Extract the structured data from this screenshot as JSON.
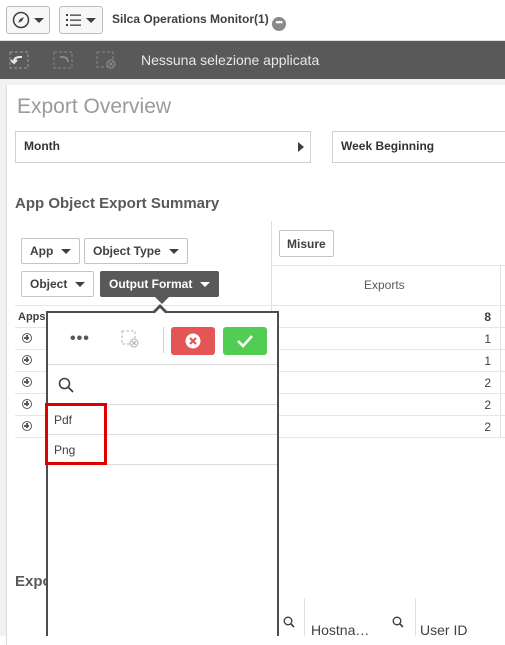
{
  "toolbar": {
    "app_title": "Silca Operations Monitor(1)",
    "more_glyph": "•••",
    "compass_icon": "compass-icon",
    "list_icon": "list-icon"
  },
  "selection_bar": {
    "text": "Nessuna selezione applicata",
    "icons": [
      "step-back-icon",
      "step-forward-icon",
      "clear-selections-icon"
    ]
  },
  "sheet": {
    "title": "Export Overview",
    "filters": [
      {
        "label": "Month"
      },
      {
        "label": "Week Beginning"
      }
    ]
  },
  "summary": {
    "title": "App Object Export Summary",
    "dimensions": [
      "App",
      "Object Type",
      "Object",
      "Output Format"
    ],
    "active_dimension": "Output Format",
    "measure_button": "Misure",
    "column_header": "Exports",
    "total_row_label": "Apps",
    "total_value": "8",
    "row_values": [
      "1",
      "1",
      "2",
      "2",
      "2"
    ]
  },
  "export_section": {
    "title": "Expo",
    "columns": [
      "Hostna…",
      "User ID"
    ]
  },
  "listbox": {
    "items": [
      "Pdf",
      "Png"
    ],
    "more_label": "•••"
  },
  "colors": {
    "selection_bar": "#595959",
    "cancel": "#e45555",
    "confirm": "#52cc52",
    "highlight": "#e00000"
  }
}
